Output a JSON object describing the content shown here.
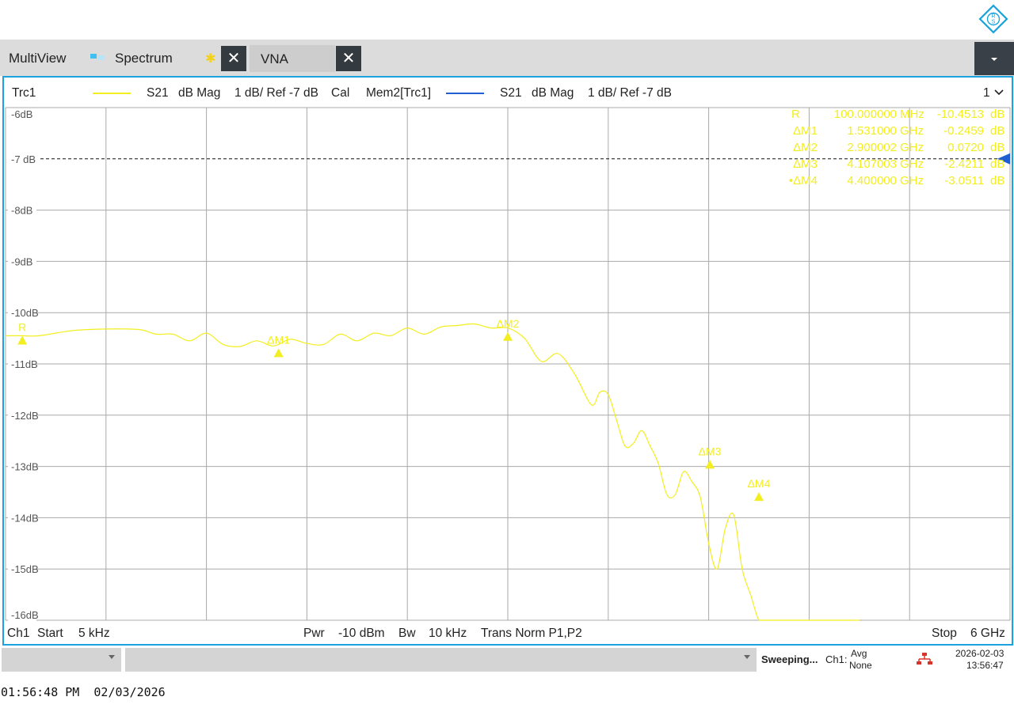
{
  "tabs": {
    "multiview": "MultiView",
    "spectrum": "Spectrum",
    "spectrum_star": "✱",
    "vna": "VNA",
    "close": "✕"
  },
  "header": {
    "trace1": "Trc1",
    "meas1": "S21",
    "format1": "dB Mag",
    "scale1": "1 dB/ Ref -7 dB",
    "cal": "Cal",
    "mem": "Mem2[Trc1]",
    "meas2": "S21",
    "format2": "dB Mag",
    "scale2": "1 dB/ Ref -7 dB",
    "window_no": "1"
  },
  "markers_table": [
    {
      "name": "R",
      "freq": "100.000000",
      "unit": "MHz",
      "value": "-10.4513",
      "vunit": "dB"
    },
    {
      "name": "ΔM1",
      "freq": "1.531000",
      "unit": "GHz",
      "value": "-0.2459",
      "vunit": "dB"
    },
    {
      "name": "ΔM2",
      "freq": "2.900002",
      "unit": "GHz",
      "value": "0.0720",
      "vunit": "dB"
    },
    {
      "name": "ΔM3",
      "freq": "4.107003",
      "unit": "GHz",
      "value": "-2.4211",
      "vunit": "dB"
    },
    {
      "name": "•ΔM4",
      "freq": "4.400000",
      "unit": "GHz",
      "value": "-3.0511",
      "vunit": "dB"
    }
  ],
  "footer": {
    "channel": "Ch1",
    "start_label": "Start",
    "start_value": "5 kHz",
    "pwr_label": "Pwr",
    "pwr_value": "-10 dBm",
    "bw_label": "Bw",
    "bw_value": "10 kHz",
    "trans": "Trans Norm P1,P2",
    "stop_label": "Stop",
    "stop_value": "6 GHz"
  },
  "status": {
    "sweeping": "Sweeping...",
    "ch": "Ch1:",
    "avg": "Avg",
    "avg_value": "None",
    "date": "2026-02-03",
    "time": "13:56:47"
  },
  "timestamp": "01:56:48 PM  02/03/2026",
  "colors": {
    "trace": "#f3ee1f",
    "memory": "#1f5fd1",
    "accent": "#1aa3de",
    "grid": "#aaaaaa"
  },
  "chart_data": {
    "type": "line",
    "title": "",
    "xlabel": "",
    "ylabel": "",
    "xlim": [
      5e-06,
      6.0
    ],
    "ylim": [
      -16,
      -6
    ],
    "y_tick_labels": [
      "-6dB",
      "-7 dB",
      "-8dB",
      "-9dB",
      "-10dB",
      "-11dB",
      "-12dB",
      "-13dB",
      "-14dB",
      "-15dB",
      "-16dB"
    ],
    "reference_level": -7,
    "grid": true,
    "series": [
      {
        "name": "Trc1",
        "x": [
          5e-06,
          0.1,
          0.2,
          0.4,
          0.6,
          0.8,
          0.9,
          1.0,
          1.1,
          1.2,
          1.3,
          1.4,
          1.5,
          1.6,
          1.7,
          1.8,
          1.9,
          2.0,
          2.1,
          2.2,
          2.3,
          2.4,
          2.5,
          2.6,
          2.7,
          2.8,
          2.9,
          3.0,
          3.1,
          3.2,
          3.3,
          3.4,
          3.5,
          3.55,
          3.6,
          3.65,
          3.7,
          3.75,
          3.8,
          3.85,
          3.9,
          3.95,
          4.0,
          4.05,
          4.1,
          4.15,
          4.2,
          4.25,
          4.3,
          4.35,
          4.4,
          4.45,
          4.5,
          4.55,
          4.6,
          4.65,
          4.7,
          4.75,
          4.8,
          4.85,
          4.9,
          4.95,
          5.0,
          5.05,
          5.1
        ],
        "y": [
          -10.45,
          -10.45,
          -10.45,
          -10.35,
          -10.32,
          -10.33,
          -10.42,
          -10.42,
          -10.55,
          -10.4,
          -10.62,
          -10.66,
          -10.55,
          -10.65,
          -10.52,
          -10.6,
          -10.62,
          -10.42,
          -10.55,
          -10.4,
          -10.45,
          -10.3,
          -10.42,
          -10.28,
          -10.25,
          -10.22,
          -10.3,
          -10.3,
          -10.5,
          -10.95,
          -10.8,
          -11.2,
          -11.8,
          -11.55,
          -11.6,
          -12.1,
          -12.6,
          -12.55,
          -12.3,
          -12.6,
          -12.95,
          -13.55,
          -13.55,
          -13.1,
          -13.3,
          -13.6,
          -14.5,
          -15.0,
          -14.2,
          -13.95,
          -15.0,
          -15.5,
          -16.0,
          -16.3,
          -16.45,
          -16.6,
          -16.5,
          -16.9,
          -16.4,
          -16.5,
          -16.8,
          -16.5,
          -16.2,
          -16.7,
          -16.5
        ]
      }
    ],
    "markers": [
      {
        "label": "R",
        "x": 0.1,
        "y": -10.4513
      },
      {
        "label": "ΔM1",
        "x": 1.631,
        "y": -10.6972
      },
      {
        "label": "ΔM2",
        "x": 3.000002,
        "y": -10.3793
      },
      {
        "label": "ΔM3",
        "x": 4.207003,
        "y": -12.8724
      },
      {
        "label": "ΔM4",
        "x": 4.5,
        "y": -13.5024
      }
    ]
  }
}
